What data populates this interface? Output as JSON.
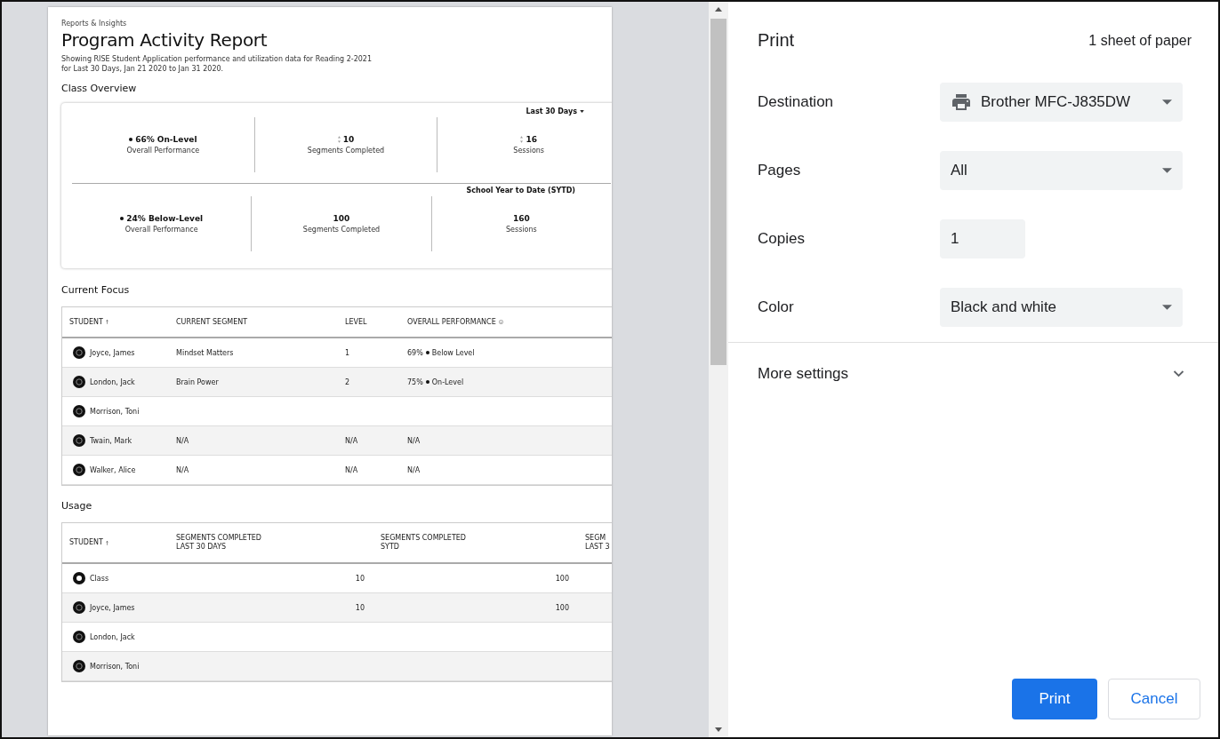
{
  "preview": {
    "breadcrumb": "Reports & Insights",
    "title": "Program Activity Report",
    "description": "Showing RISE Student Application performance and utilization data for Reading 2-2021 for Last 30 Days, Jan 21 2020 to Jan 31 2020.",
    "class_overview": {
      "heading": "Class Overview",
      "periods": [
        {
          "label": "Last 30 Days",
          "dropdown": true,
          "metrics": [
            {
              "kind": "performance",
              "value": "66% On-Level",
              "label": "Overall Performance"
            },
            {
              "kind": "trend",
              "value": "10",
              "label": "Segments Completed"
            },
            {
              "kind": "trend",
              "value": "16",
              "label": "Sessions"
            }
          ]
        },
        {
          "label": "School Year to Date (SYTD)",
          "dropdown": false,
          "metrics": [
            {
              "kind": "performance",
              "value": "24% Below-Level",
              "label": "Overall Performance"
            },
            {
              "kind": "count",
              "value": "100",
              "label": "Segments Completed"
            },
            {
              "kind": "count",
              "value": "160",
              "label": "Sessions"
            }
          ]
        }
      ]
    },
    "current_focus": {
      "heading": "Current Focus",
      "columns": [
        {
          "label": "STUDENT",
          "kind": "sortable"
        },
        {
          "label": "CURRENT SEGMENT",
          "kind": "plain"
        },
        {
          "label": "LEVEL",
          "kind": "plain"
        },
        {
          "label": "OVERALL PERFORMANCE",
          "kind": "info"
        }
      ],
      "rows": [
        {
          "student": "Joyce, James",
          "segment": "Mindset Matters",
          "level": "1",
          "performance": "69%",
          "status": "Below Level"
        },
        {
          "student": "London, Jack",
          "segment": "Brain Power",
          "level": "2",
          "performance": "75%",
          "status": "On-Level"
        },
        {
          "student": "Morrison, Toni"
        },
        {
          "student": "Twain, Mark",
          "segment": "N/A",
          "level": "N/A",
          "performance": "N/A"
        },
        {
          "student": "Walker, Alice",
          "segment": "N/A",
          "level": "N/A",
          "performance": "N/A"
        }
      ]
    },
    "usage": {
      "heading": "Usage",
      "columns": [
        {
          "label": "STUDENT",
          "kind": "sortable"
        },
        {
          "label": "SEGMENTS COMPLETED",
          "sublabel": "LAST 30 DAYS",
          "kind": "plain"
        },
        {
          "label": "SEGMENTS COMPLETED",
          "sublabel": "SYTD",
          "kind": "plain"
        },
        {
          "label": "SEGM",
          "sublabel": "LAST 3",
          "kind": "plain"
        }
      ],
      "rows": [
        {
          "student": "Class",
          "kind": "class",
          "last30": "10",
          "sytd": "100"
        },
        {
          "student": "Joyce, James",
          "kind": "student",
          "last30": "10",
          "sytd": "100"
        },
        {
          "student": "London, Jack",
          "kind": "student"
        },
        {
          "student": "Morrison, Toni",
          "kind": "student"
        }
      ]
    }
  },
  "print": {
    "title": "Print",
    "sheets": "1 sheet of paper",
    "settings": [
      {
        "kind": "printer",
        "label": "Destination",
        "value": "Brother MFC-J835DW"
      },
      {
        "kind": "select",
        "label": "Pages",
        "value": "All"
      },
      {
        "kind": "input",
        "label": "Copies",
        "value": "1"
      },
      {
        "kind": "select",
        "label": "Color",
        "value": "Black and white"
      }
    ],
    "more_settings": {
      "label": "More settings",
      "expanded": false
    },
    "buttons": [
      {
        "label": "Print",
        "kind": "primary"
      },
      {
        "label": "Cancel",
        "kind": "secondary"
      }
    ]
  }
}
